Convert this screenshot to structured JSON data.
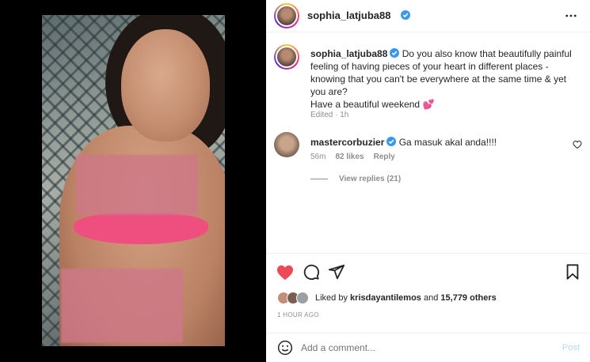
{
  "post": {
    "author": "sophia_latjuba88",
    "caption_lines": [
      "Do you also know that beautifully painful",
      "feeling of having pieces of your heart in different places -",
      "knowing that you can't be everywhere at the same time & yet",
      "you are?",
      "Have a beautiful weekend"
    ],
    "caption_emoji": "💕",
    "edited": "Edited · 1h"
  },
  "comment": {
    "author": "mastercorbuzier",
    "text": "Ga masuk akal anda!!!!",
    "time": "56m",
    "likes": "82 likes",
    "reply": "Reply",
    "view_replies": "View replies (21)"
  },
  "likes_row": {
    "prefix": "Liked by",
    "user": "krisdayantilemos",
    "connector": "and",
    "others": "15,779 others"
  },
  "timestamp": "1 HOUR AGO",
  "add_comment": {
    "placeholder": "Add a comment...",
    "post_label": "Post"
  },
  "colors": {
    "like_red": "#ed4956",
    "verified_blue": "#3897f0",
    "post_button": "#b3dbff"
  },
  "icons": [
    "more-options-icon",
    "verified-badge-icon",
    "heart-icon",
    "comment-icon",
    "share-icon",
    "bookmark-icon",
    "emoji-icon",
    "small-heart-icon"
  ]
}
